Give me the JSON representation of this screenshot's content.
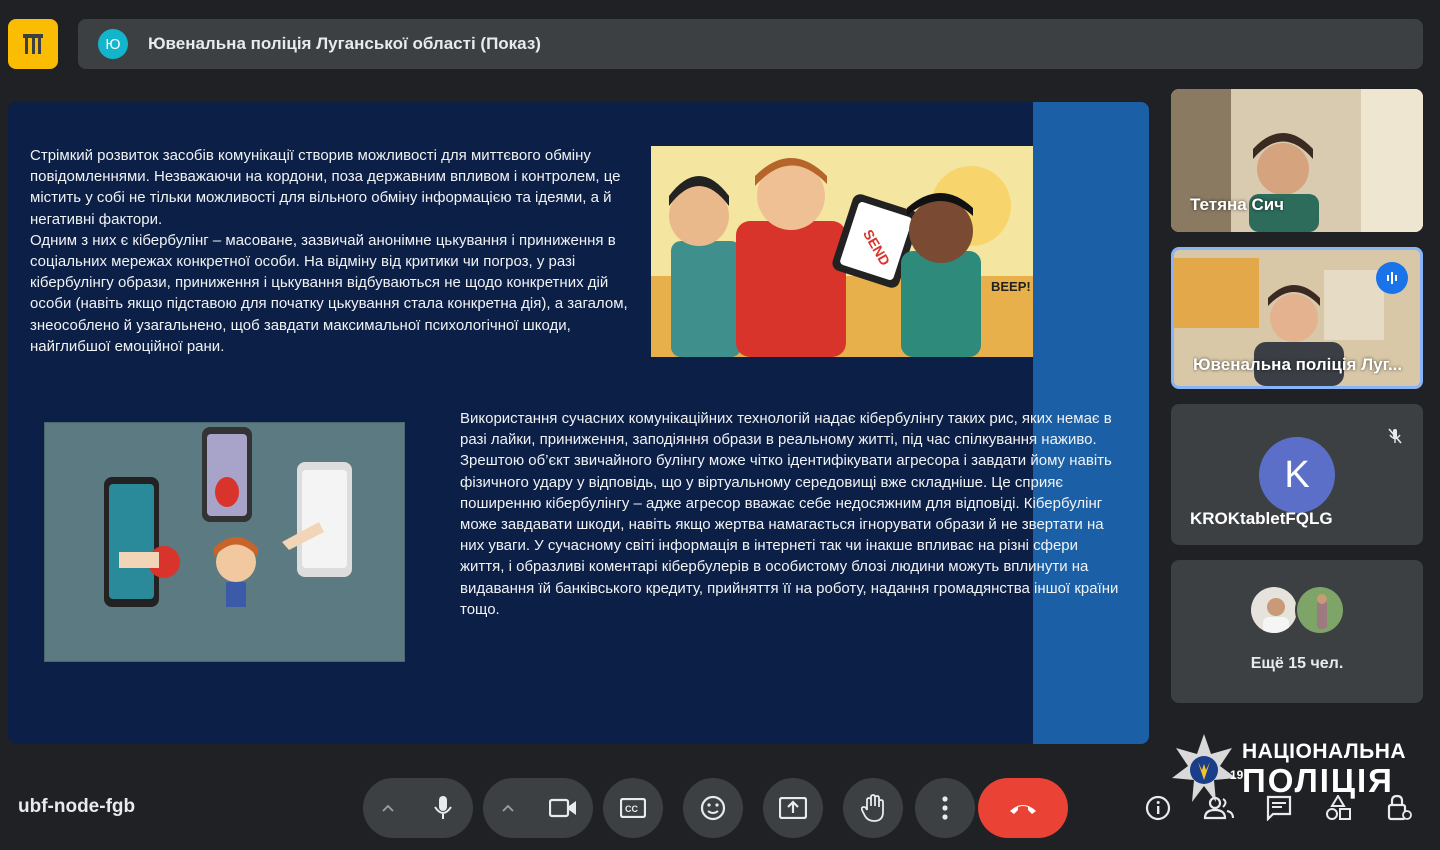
{
  "presentation": {
    "presenter_initial": "Ю",
    "title": "Ювенальна поліція Луганської області (Показ)"
  },
  "slide": {
    "paragraph1": "Стрімкий розвиток засобів комунікації створив можливості для миттєвого обміну повідомленнями. Незважаючи на кордони, поза державним впливом і контролем, це містить у собі не тільки можливості для вільного обміну інформацією та ідеями, а й негативні фактори.\nОдним з них є кібербулінг – масоване, зазвичай анонімне цькування і приниження в соціальних мережах конкретної особи. На відміну від критики чи погроз, у разі кібербулінгу образи, приниження і цькування відбуваються не щодо конкретних дій особи (навіть якщо підставою для початку цькування стала конкретна дія), а загалом, знеособлено й узагальнено, щоб завдати максимальної психологічної шкоди, найглибшої емоційної рани.",
    "paragraph2": "Використання сучасних комунікаційних технологій надає кібербулінгу таких рис, яких немає в разі лайки, приниження, заподіяння образи в реальному житті, під час спілкування наживо. Зрештою об’єкт звичайного булінгу може чітко ідентифікувати агресора і завдати йому навіть фізичного удару у відповідь, що у віртуальному середовищі вже складніше. Це сприяє поширенню кібербулінгу – адже агресор вважає себе недосяжним для відповіді. Кібербулінг може завдавати шкоди, навіть якщо жертва намагається ігнорувати образи й не звертати на них уваги. У сучасному світі інформація в інтернеті так чи інакше впливає на різні сфери життя, і образливі коментарі кібербулерів в особистому блозі людини можуть вплинути на видавання їй банківського кредиту, прийняття її на роботу, надання громадянства іншої країни тощо.",
    "img1_send": "SEND",
    "img1_beep": "BEEP!"
  },
  "participants": [
    {
      "name": "Тетяна Сич"
    },
    {
      "name": "Ювенальна поліція Луг..."
    },
    {
      "name": "KROKtabletFQLG",
      "initial": "K"
    }
  ],
  "more_participants": "Ещё 15 чел.",
  "meeting_code": "ubf-node-fgb",
  "watermark": {
    "line1": "НАЦІОНАЛЬНА",
    "line2": "ПОЛІЦІЯ",
    "badge": "19"
  },
  "colors": {
    "end_call": "#ea4335",
    "accent": "#8ab4f8",
    "logo": "#fbbc04"
  }
}
